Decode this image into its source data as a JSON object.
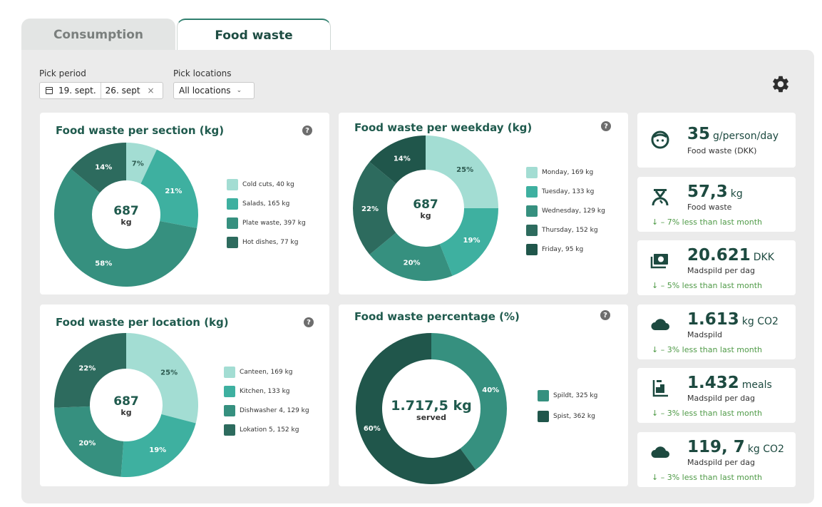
{
  "tabs": [
    {
      "label": "Consumption",
      "active": false
    },
    {
      "label": "Food waste",
      "active": true
    }
  ],
  "filters": {
    "period_label": "Pick period",
    "start_date": "19. sept.",
    "end_date": "26. sept",
    "clear_symbol": "×",
    "locations_label": "Pick locations",
    "locations_value": "All locations"
  },
  "icons": {
    "gear": "gear-icon",
    "help": "?",
    "kpi": [
      "face-icon",
      "scale-icon",
      "money-icon",
      "cloud-icon",
      "meals-icon",
      "cloud-icon"
    ]
  },
  "colors": {
    "c1": "#a3ddd3",
    "c2": "#3eb0a0",
    "c3": "#36907f",
    "c4": "#2d6b5e",
    "c5": "#20564b",
    "accent": "#1f5a4d",
    "trend": "#4f9a47"
  },
  "chart_data": [
    {
      "type": "pie",
      "title": "Food waste per section (kg)",
      "center_value": "687",
      "center_unit": "kg",
      "categories": [
        "Cold cuts, 40 kg",
        "Salads, 165 kg",
        "Plate waste, 397 kg",
        "Hot dishes, 77 kg"
      ],
      "values": [
        7,
        21,
        58,
        14
      ],
      "labels": [
        "7%",
        "21%",
        "58%",
        "14%"
      ],
      "colors": [
        "#a3ddd3",
        "#3eb0a0",
        "#36907f",
        "#2d6b5e"
      ]
    },
    {
      "type": "pie",
      "title": "Food waste per weekday (kg)",
      "center_value": "687",
      "center_unit": "kg",
      "categories": [
        "Monday, 169 kg",
        "Tuesday, 133 kg",
        "Wednesday, 129 kg",
        "Thursday, 152 kg",
        "Friday, 95 kg"
      ],
      "values": [
        25,
        19,
        20,
        22,
        14
      ],
      "labels": [
        "25%",
        "19%",
        "20%",
        "22%",
        "14%"
      ],
      "colors": [
        "#a3ddd3",
        "#3eb0a0",
        "#36907f",
        "#2d6b5e",
        "#20564b"
      ]
    },
    {
      "type": "pie",
      "title": "Food waste per location (kg)",
      "center_value": "687",
      "center_unit": "kg",
      "categories": [
        "Canteen, 169 kg",
        "Kitchen, 133 kg",
        "Dishwasher 4, 129 kg",
        "Lokation 5, 152 kg"
      ],
      "values": [
        25,
        19,
        20,
        22
      ],
      "labels": [
        "25%",
        "19%",
        "20%",
        "22%"
      ],
      "colors": [
        "#a3ddd3",
        "#3eb0a0",
        "#36907f",
        "#2d6b5e"
      ]
    },
    {
      "type": "pie",
      "title": "Food waste percentage (%)",
      "center_value": "1.717,5 kg",
      "center_unit": "served",
      "categories": [
        "Spildt, 325 kg",
        "Spist, 362 kg"
      ],
      "values": [
        40,
        60
      ],
      "labels": [
        "40%",
        "60%"
      ],
      "colors": [
        "#36907f",
        "#20564b"
      ]
    }
  ],
  "kpis": [
    {
      "value": "35",
      "unit": "g/person/day",
      "sub": "Food waste (DKK)",
      "trend": ""
    },
    {
      "value": "57,3",
      "unit": "kg",
      "sub": "Food waste",
      "trend": "↓ – 7% less than last month"
    },
    {
      "value": "20.621",
      "unit": "DKK",
      "sub": "Madspild per dag",
      "trend": "↓ – 5% less than last month"
    },
    {
      "value": "1.613",
      "unit": "kg CO2",
      "sub": "Madspild",
      "trend": "↓ – 3% less than last month"
    },
    {
      "value": "1.432",
      "unit": "meals",
      "sub": "Madspild per dag",
      "trend": "↓ – 3% less than last month"
    },
    {
      "value": "119, 7",
      "unit": "kg CO2",
      "sub": "Madspild per dag",
      "trend": "↓ – 3% less than last month"
    }
  ]
}
